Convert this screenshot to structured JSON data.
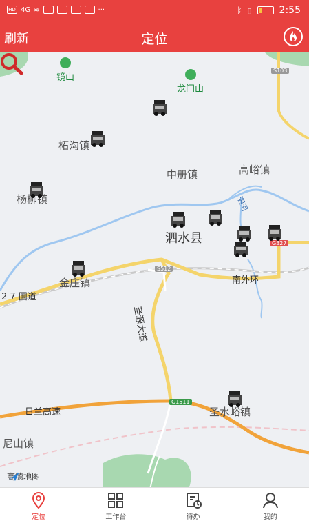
{
  "status": {
    "time": "2:55",
    "signal_label": "4G",
    "more": "···"
  },
  "header": {
    "refresh_label": "刷新",
    "title": "定位"
  },
  "map": {
    "pois": [
      {
        "label": "镜山"
      },
      {
        "label": "龙门山"
      }
    ],
    "places": [
      {
        "label": "柘沟镇"
      },
      {
        "label": "中册镇"
      },
      {
        "label": "高峪镇"
      },
      {
        "label": "杨柳镇"
      },
      {
        "label": "金庄镇"
      },
      {
        "label": "南外环"
      },
      {
        "label": "圣水峪镇"
      },
      {
        "label": "尼山镇"
      }
    ],
    "county_label": "泗水县",
    "roads": {
      "s103": "S103",
      "s512": "S512",
      "g327": "G327",
      "g1511": "G1511",
      "guodao": "2 7 国道",
      "shengyuan": "圣源大道",
      "rilan": "日兰高速",
      "river": "泗河"
    },
    "watermark": "高德地图"
  },
  "tabs": [
    {
      "label": "定位",
      "icon": "location-icon",
      "active": true
    },
    {
      "label": "工作台",
      "icon": "grid-icon",
      "active": false
    },
    {
      "label": "待办",
      "icon": "todo-icon",
      "active": false
    },
    {
      "label": "我的",
      "icon": "user-icon",
      "active": false
    }
  ],
  "colors": {
    "brand": "#e8413f"
  }
}
